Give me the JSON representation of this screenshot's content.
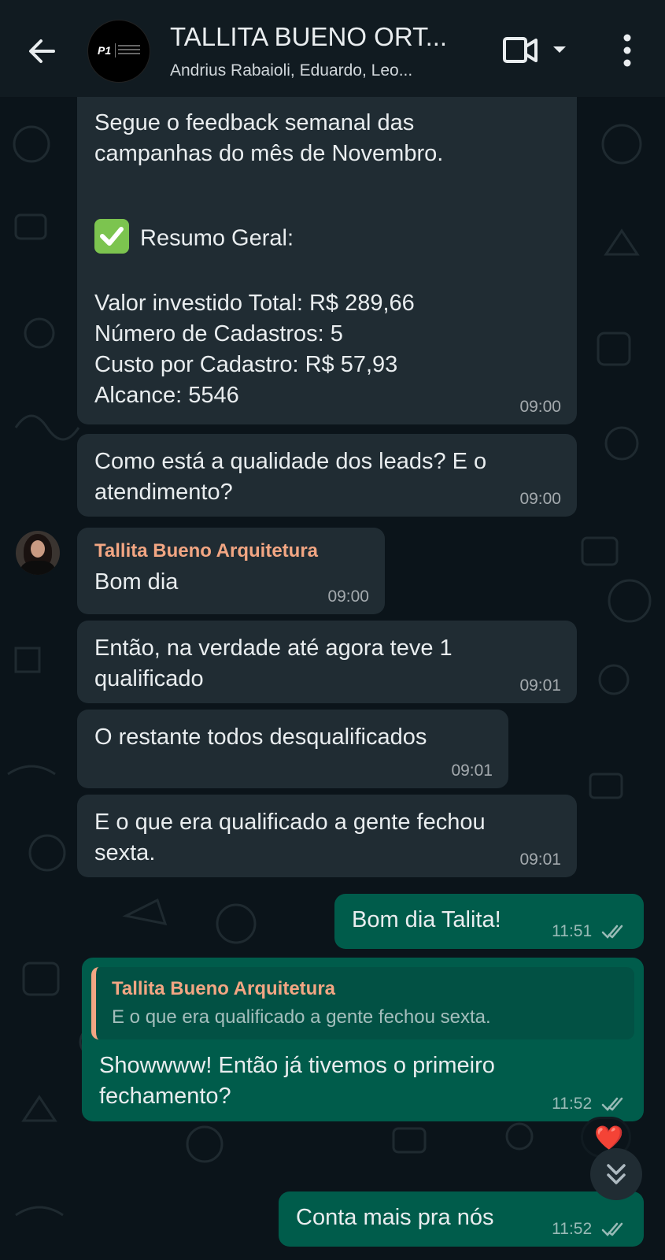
{
  "header": {
    "title": "TALLITA BUENO ORT...",
    "participants": "Andrius Rabaioli, Eduardo, Leo...",
    "avatar_logo_text": "P1",
    "icons": [
      "back-arrow-icon",
      "video-call-icon",
      "dropdown-caret-icon",
      "more-vert-icon"
    ]
  },
  "messages": [
    {
      "id": "m1",
      "direction": "in",
      "intro": "Segue o feedback semanal das\ncampanhas do mês de Novembro.",
      "heading": "Resumo Geral:",
      "heading_emoji": "white-check-mark-icon",
      "stats": "Valor investido Total: R$ 289,66\nNúmero de Cadastros: 5\nCusto por Cadastro: R$ 57,93\nAlcance: 5546",
      "time": "09:00"
    },
    {
      "id": "m2",
      "direction": "in",
      "text": "Como está a qualidade dos leads? E o\natendimento?",
      "time": "09:00"
    },
    {
      "id": "m3",
      "direction": "in",
      "sender": "Tallita Bueno Arquitetura",
      "text": "Bom dia",
      "time": "09:00"
    },
    {
      "id": "m4",
      "direction": "in",
      "text": "Então, na verdade até agora teve 1\nqualificado",
      "time": "09:01"
    },
    {
      "id": "m5",
      "direction": "in",
      "text": "O restante todos desqualificados",
      "time": "09:01"
    },
    {
      "id": "m6",
      "direction": "in",
      "text": "E o que era qualificado a gente fechou\nsexta.",
      "time": "09:01"
    },
    {
      "id": "m7",
      "direction": "out",
      "text": "Bom dia Talita!",
      "time": "11:51",
      "status": "read"
    },
    {
      "id": "m8",
      "direction": "out",
      "quote": {
        "sender": "Tallita Bueno Arquitetura",
        "text": "E o que era qualificado a gente fechou sexta."
      },
      "text": "Showwww! Então já tivemos o primeiro\nfechamento?",
      "time": "11:52",
      "status": "read",
      "reaction": "❤️"
    },
    {
      "id": "m9",
      "direction": "out",
      "text": "Conta mais pra nós",
      "time": "11:52",
      "status": "read"
    }
  ],
  "colors": {
    "app_bg": "#0b141a",
    "header_bg": "#111b21",
    "incoming_bubble": "#202c33",
    "outgoing_bubble": "#005c4b",
    "sender_name": "#f2a683",
    "text": "#e9edef"
  }
}
